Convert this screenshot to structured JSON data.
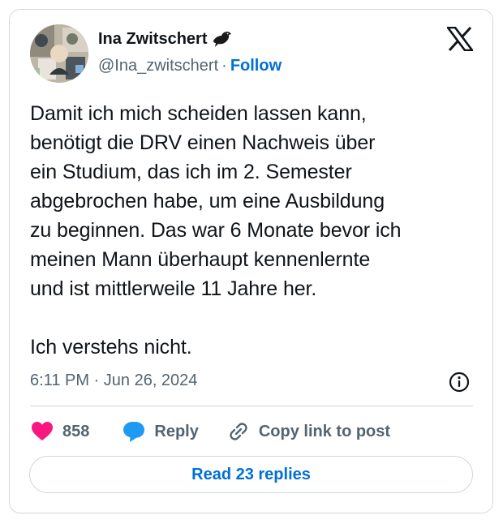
{
  "author": {
    "display_name": "Ina Zwitschert",
    "handle": "@Ina_zwitschert",
    "separator": "·",
    "follow_label": "Follow",
    "name_emoji_icon": "black-bird-icon"
  },
  "tweet": {
    "text": "Damit ich mich scheiden lassen kann,\nbenötigt die DRV einen Nachweis über\nein Studium, das ich im 2. Semester\nabgebrochen habe, um eine Ausbildung\nzu beginnen. Das war 6 Monate bevor ich\nmeinen Mann überhaupt kennenlernte\nund ist mittlerweile 11 Jahre her.\n\nIch verstehs nicht.",
    "timestamp": "6:11 PM · Jun 26, 2024"
  },
  "actions": {
    "likes_count": "858",
    "reply_label": "Reply",
    "copy_link_label": "Copy link to post"
  },
  "read_replies_label": "Read 23 replies",
  "colors": {
    "accent": "#006fd6",
    "like": "#f91880",
    "reply_icon": "#1d9bf0",
    "muted_text": "#536471",
    "border": "#cfd9de"
  }
}
